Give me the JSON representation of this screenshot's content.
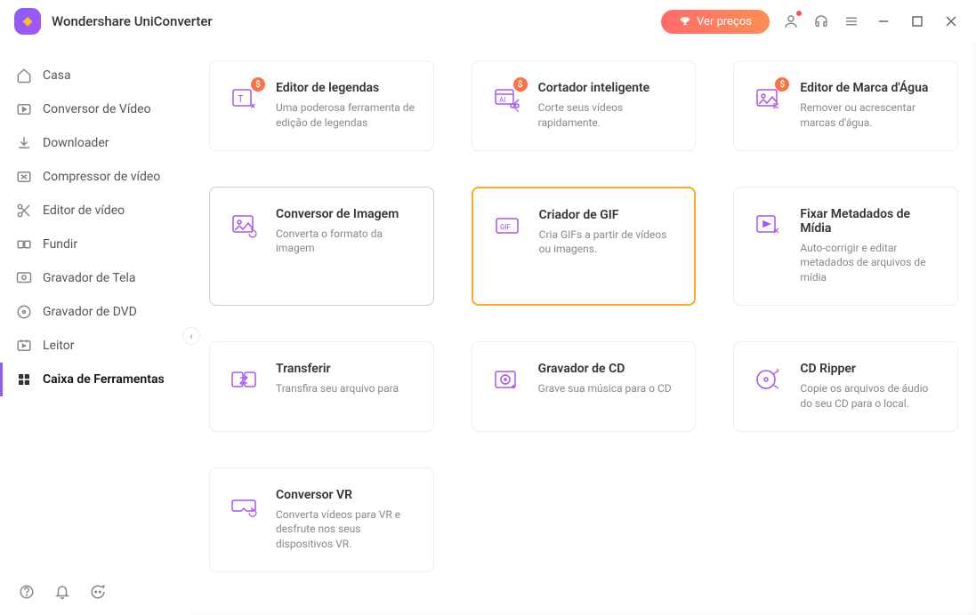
{
  "app": {
    "title": "Wondershare UniConverter"
  },
  "titlebar": {
    "price_button": "Ver preços"
  },
  "sidebar": {
    "items": [
      {
        "label": "Casa"
      },
      {
        "label": "Conversor de Vídeo"
      },
      {
        "label": "Downloader"
      },
      {
        "label": "Compressor de vídeo"
      },
      {
        "label": "Editor de vídeo"
      },
      {
        "label": "Fundir"
      },
      {
        "label": "Gravador de Tela"
      },
      {
        "label": "Gravador de DVD"
      },
      {
        "label": "Leitor"
      },
      {
        "label": "Caixa de Ferramentas"
      }
    ]
  },
  "tools": [
    {
      "title": "Editor de legendas",
      "desc": "Uma poderosa ferramenta de edição de legendas",
      "badge": "$"
    },
    {
      "title": "Cortador inteligente",
      "desc": "Corte seus vídeos rapidamente.",
      "badge": "$"
    },
    {
      "title": "Editor de Marca d'Água",
      "desc": "Remover ou acrescentar marcas d'água.",
      "badge": "$"
    },
    {
      "title": "Conversor de Imagem",
      "desc": "Converta o formato da imagem"
    },
    {
      "title": "Criador de GIF",
      "desc": "Cria GIFs a partir de vídeos ou imagens."
    },
    {
      "title": "Fixar Metadados de Mídia",
      "desc": "Auto-corrigir e editar metadados de arquivos de mídia"
    },
    {
      "title": "Transferir",
      "desc": "Transfira seu arquivo para"
    },
    {
      "title": "Gravador de CD",
      "desc": "Grave sua música para o CD"
    },
    {
      "title": "CD Ripper",
      "desc": "Copie os arquivos de áudio do seu CD para o local."
    },
    {
      "title": "Conversor VR",
      "desc": "Converta vídeos para VR e desfrute nos seus dispositivos VR."
    }
  ]
}
